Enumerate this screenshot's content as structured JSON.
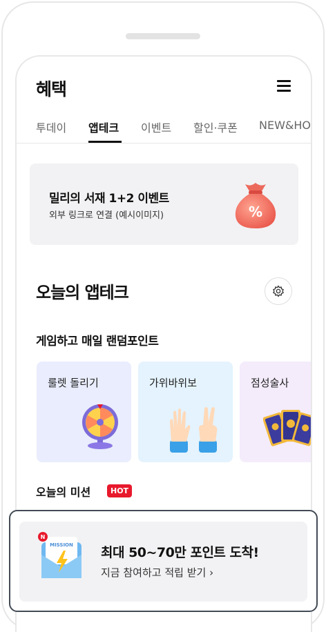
{
  "header": {
    "title": "혜택"
  },
  "tabs": [
    {
      "label": "투데이"
    },
    {
      "label": "앱테크"
    },
    {
      "label": "이벤트"
    },
    {
      "label": "할인·쿠폰"
    },
    {
      "label": "NEW&HOT"
    }
  ],
  "banner": {
    "title": "밀리의 서재 1+2 이벤트",
    "subtitle": "외부 링크로 연결 (예시이미지)",
    "icon": "money-bag-percent"
  },
  "apptech": {
    "title": "오늘의 앱테크",
    "settings_icon": "gear-icon"
  },
  "games": {
    "title": "게임하고 매일 랜덤포인트",
    "items": [
      {
        "label": "룰렛 돌리기",
        "icon": "roulette-wheel"
      },
      {
        "label": "가위바위보",
        "icon": "rock-paper-scissors-hands"
      },
      {
        "label": "점성술사",
        "icon": "tarot-cards"
      }
    ]
  },
  "missions": {
    "title": "오늘의 미션",
    "badge": "HOT",
    "card": {
      "badge_letter": "N",
      "envelope_text": "MISSION",
      "title": "최대 50~70만 포인트 도착!",
      "subtitle": "지금 참여하고 적립 받기 ›"
    }
  },
  "colors": {
    "accent_red": "#e8192c",
    "card_bg": "#f2f2f4",
    "frame": "#424a54"
  }
}
